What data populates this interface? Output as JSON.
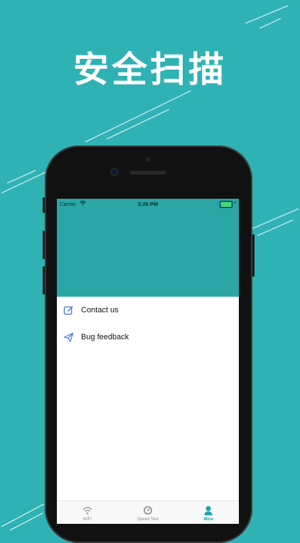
{
  "promo": {
    "headline": "安全扫描"
  },
  "status_bar": {
    "carrier": "Carrier",
    "time": "3:25 PM"
  },
  "menu": {
    "items": [
      {
        "label": "Contact us",
        "icon": "edit-icon"
      },
      {
        "label": "Bug feedback",
        "icon": "paper-plane-icon"
      }
    ]
  },
  "tab_bar": {
    "tabs": [
      {
        "label": "WiFi",
        "icon": "wifi-icon",
        "active": false
      },
      {
        "label": "Speed Test",
        "icon": "speedometer-icon",
        "active": false
      },
      {
        "label": "Mine",
        "icon": "person-icon",
        "active": true
      }
    ]
  },
  "colors": {
    "background": "#2fb2b4",
    "header": "#2aa6a7",
    "accent": "#1ea7b0",
    "icon_blue": "#4a78d8"
  }
}
